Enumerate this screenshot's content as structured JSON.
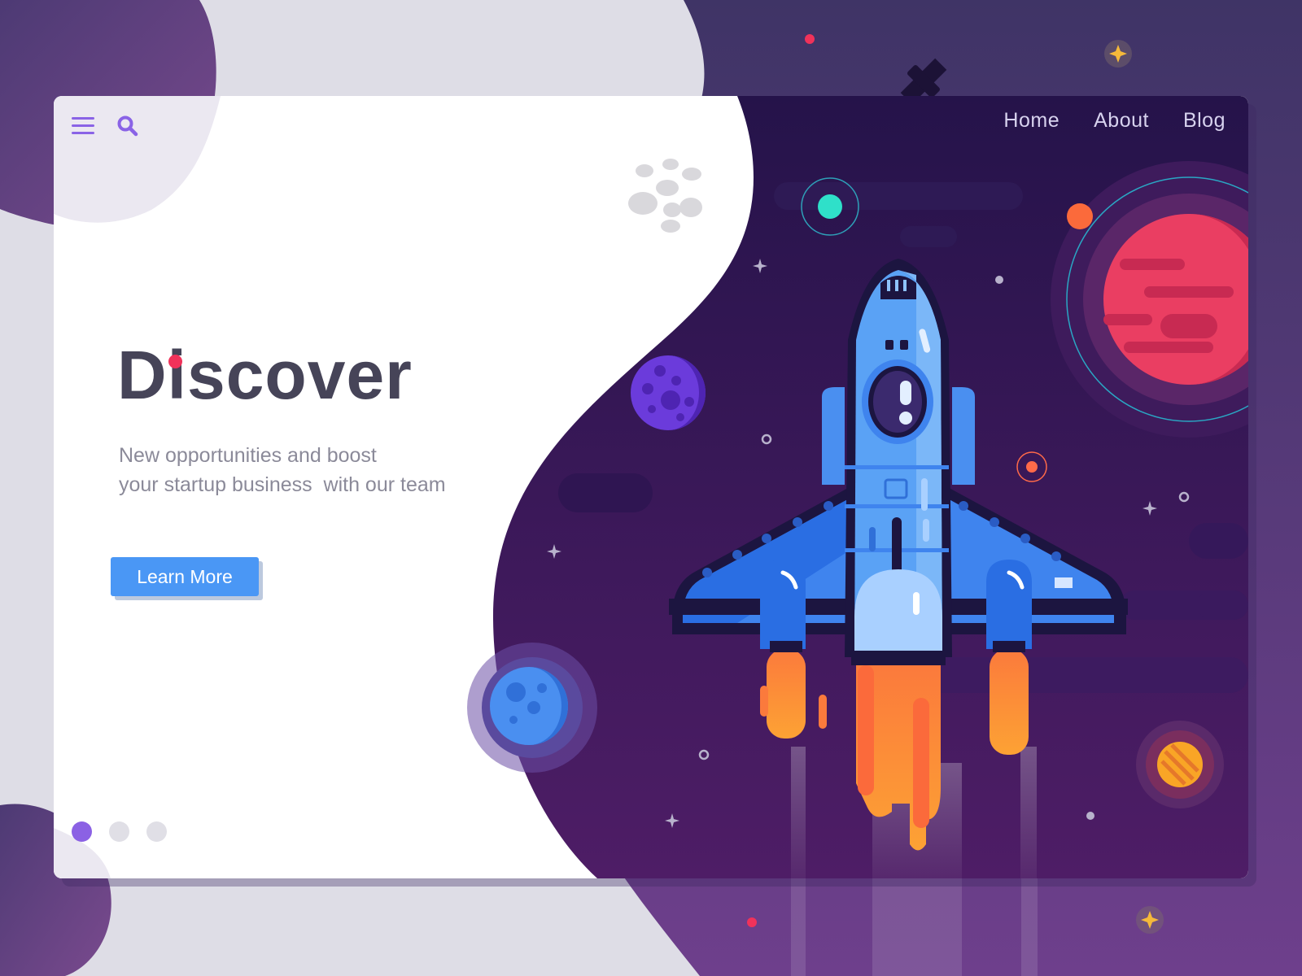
{
  "nav": {
    "items": [
      {
        "label": "Home"
      },
      {
        "label": "About"
      },
      {
        "label": "Blog"
      }
    ]
  },
  "toolbar": {
    "menu_icon": "hamburger-menu-icon",
    "search_icon": "search-icon"
  },
  "hero": {
    "title": "Discover",
    "subtitle_lines": [
      "New opportunities and boost",
      "your startup business  with our team"
    ],
    "cta_label": "Learn More"
  },
  "pager": {
    "count": 3,
    "active_index": 0
  },
  "colors": {
    "brand_purple": "#8b61e4",
    "accent_red": "#f0325a",
    "cta_blue": "#4a97f5",
    "space_dark": "#2a1650",
    "space_light": "#6a3a8c",
    "title_text": "#464458",
    "body_text": "#8b8a99"
  }
}
